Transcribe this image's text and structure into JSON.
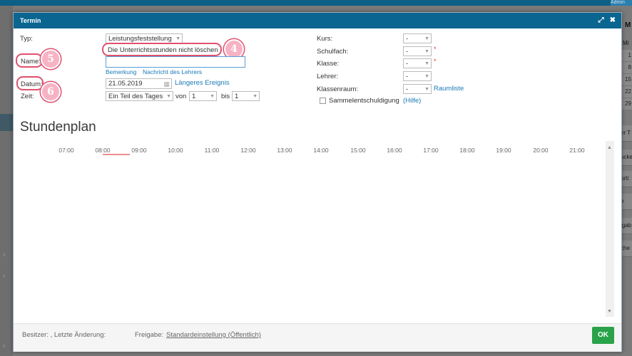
{
  "background": {
    "admin_label": "Admin",
    "calendar_header": "M",
    "calendar_weekday": "Mi",
    "calendar_days": [
      "1",
      "8",
      "15",
      "22",
      "29"
    ],
    "side_items": [
      "er T",
      "ucke",
      "orti",
      "e",
      "igab",
      "che"
    ]
  },
  "dialog": {
    "title": "Termin",
    "expand_icon": "expand-icon",
    "close_icon": "close-icon"
  },
  "form": {
    "typ_label": "Typ:",
    "typ_value": "Leistungsfeststellung",
    "delete_hours_label": "Die Unterrichtsstunden nicht löschen",
    "name_label": "Name:",
    "name_value": "",
    "bemerkung_link": "Bemerkung",
    "nachricht_link": "Nachricht des Lehrers",
    "datum_label": "Datum:",
    "datum_value": "21.05.2019",
    "langeres_link": "Längeres Ereignis",
    "zeit_label": "Zeit:",
    "zeit_value": "Ein Teil des Tages",
    "von_label": "von",
    "von_value": "1",
    "bis_label": "bis",
    "bis_value": "1",
    "kurs_label": "Kurs:",
    "kurs_value": "-",
    "schulfach_label": "Schulfach:",
    "schulfach_value": "-",
    "klasse_label": "Klasse:",
    "klasse_value": "-",
    "lehrer_label": "Lehrer:",
    "lehrer_value": "-",
    "klassenraum_label": "Klassenraum:",
    "klassenraum_value": "-",
    "raumliste_link": "Raumliste",
    "sammel_label": "Sammelentschuldigung",
    "hilfe_link": "(Hilfe)",
    "required_mark": "*"
  },
  "callouts": {
    "four": "4",
    "five": "5",
    "six": "6"
  },
  "schedule": {
    "title": "Stundenplan",
    "hours": [
      "07:00",
      "08:00",
      "09:00",
      "10:00",
      "11:00",
      "12:00",
      "13:00",
      "14:00",
      "15:00",
      "16:00",
      "17:00",
      "18:00",
      "19:00",
      "20:00",
      "21:00"
    ]
  },
  "footer": {
    "owner_text": "Besitzer: , Letzte Änderung:",
    "freigabe_label": "Freigabe:",
    "freigabe_link": "Standardeinstellung (Öffentlich)",
    "ok_label": "OK"
  },
  "colors": {
    "header": "#0a6591",
    "ok_button": "#2aa24a",
    "callout": "#e0506f",
    "link": "#1a7ab8"
  }
}
